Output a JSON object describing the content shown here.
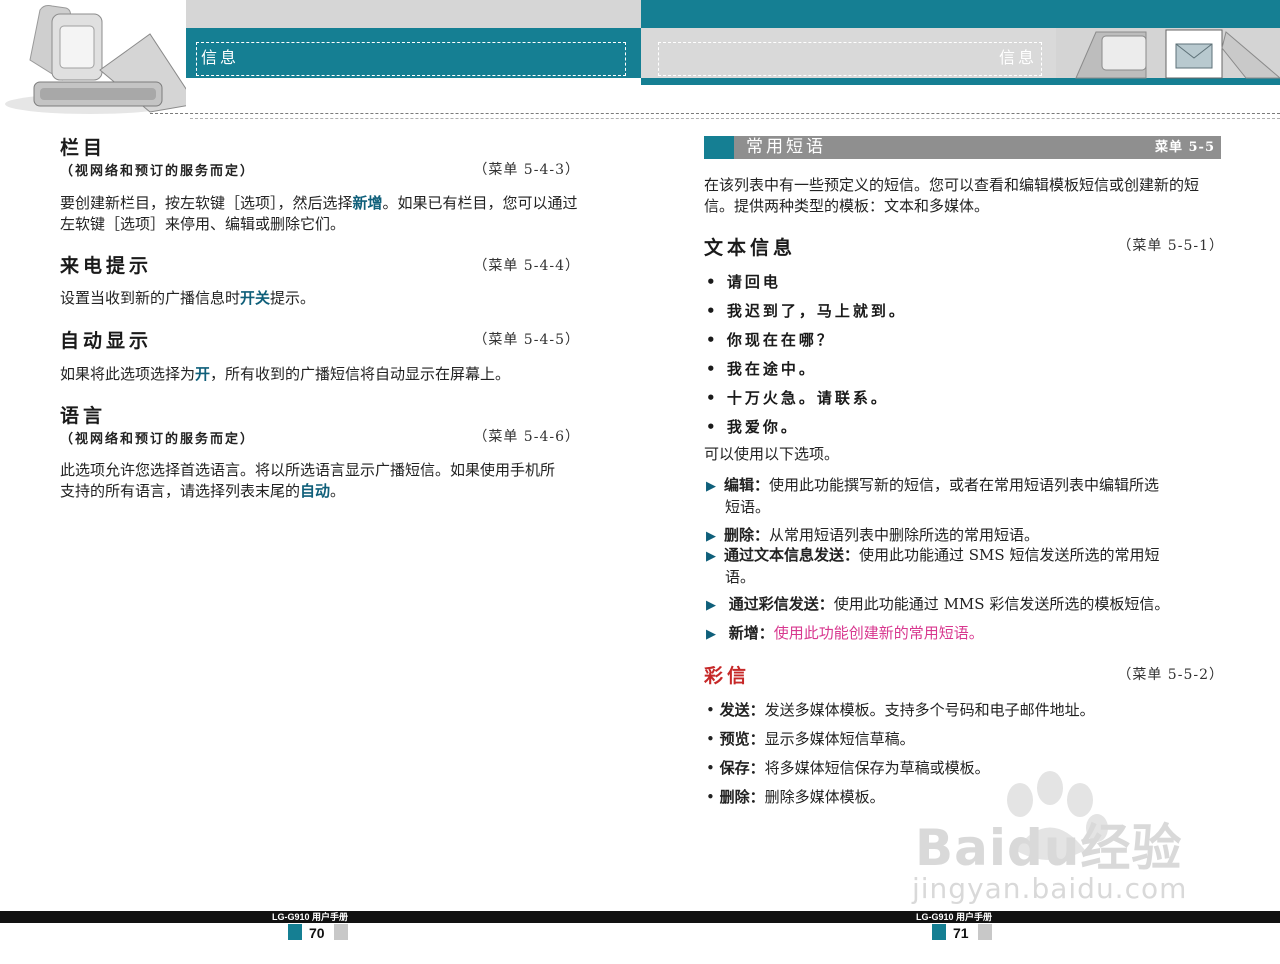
{
  "header": {
    "left_tab": "信息",
    "right_tab": "信息"
  },
  "left_page": {
    "sections": [
      {
        "title": "栏目",
        "subtitle": "（视网络和预订的服务而定）",
        "menu_ref": "（菜单 5-4-3）",
        "body_pre": "要创建新栏目，按左软键［选项］，然后选择",
        "body_hl": "新增",
        "body_post": "。如果已有栏目，您可以通过左软键［选项］来停用、编辑或删除它们。"
      },
      {
        "title": "来电提示",
        "menu_ref": "（菜单 5-4-4）",
        "body_pre": "设置当收到新的广播信息时",
        "body_hl": "开关",
        "body_post": "提示。"
      },
      {
        "title": "自动显示",
        "menu_ref": "（菜单 5-4-5）",
        "body_pre": "如果将此选项选择为",
        "body_hl": "开",
        "body_post": "，所有收到的广播短信将自动显示在屏幕上。"
      },
      {
        "title": "语言",
        "subtitle": "（视网络和预订的服务而定）",
        "menu_ref": "（菜单 5-4-6）",
        "body_pre": "此选项允许您选择首选语言。将以所选语言显示广播短信。如果使用手机所支持的所有语言，请选择列表末尾的",
        "body_hl": "自动",
        "body_post": "。"
      }
    ]
  },
  "right_page": {
    "bar_title": "常用短语",
    "bar_ref": "菜单 5-5",
    "intro": "在该列表中有一些预定义的短信。您可以查看和编辑模板短信或创建新的短信。提供两种类型的模板：文本和多媒体。",
    "text_section": {
      "title": "文本信息",
      "menu_ref": "（菜单 5-5-1）",
      "bullets": [
        "请回电",
        "我迟到了，马上就到。",
        "你现在在哪？",
        "我在途中。",
        "十万火急。请联系。",
        "我爱你。"
      ],
      "options_intro": "可以使用以下选项。",
      "options": [
        {
          "label": "编辑：",
          "text": "使用此功能撰写新的短信，或者在常用短语列表中编辑所选",
          "cont": "短语。"
        },
        {
          "label": "删除：",
          "text": "从常用短语列表中删除所选的常用短语。",
          "cont": ""
        },
        {
          "label": "通过文本信息发送：",
          "text": "使用此功能通过 SMS 短信发送所选的常用短",
          "cont": "语。"
        },
        {
          "label": "通过彩信发送：",
          "text": "使用此功能通过 MMS 彩信发送所选的模板短信。",
          "cont": ""
        },
        {
          "label": "新增：",
          "text": "使用此功能创建新的常用短语。",
          "cont": ""
        }
      ]
    },
    "mms_section": {
      "title": "彩信",
      "menu_ref": "（菜单 5-5-2）",
      "items": [
        {
          "label": "发送：",
          "text": "发送多媒体模板。支持多个号码和电子邮件地址。"
        },
        {
          "label": "预览：",
          "text": "显示多媒体短信草稿。"
        },
        {
          "label": "保存：",
          "text": "将多媒体短信保存为草稿或模板。"
        },
        {
          "label": "删除：",
          "text": "删除多媒体模板。"
        }
      ]
    }
  },
  "footer": {
    "manual_label_left": "LG-G910 用户手册",
    "manual_label_right": "LG-G910 用户手册",
    "page_left": "70",
    "page_right": "71"
  },
  "watermark": {
    "brand": "Baidu经验",
    "url": "jingyan.baidu.com"
  },
  "colors": {
    "teal": "#157f93",
    "highlight": "#0f5f7a",
    "mms_title": "#c62828",
    "pink": "#d8388f"
  }
}
